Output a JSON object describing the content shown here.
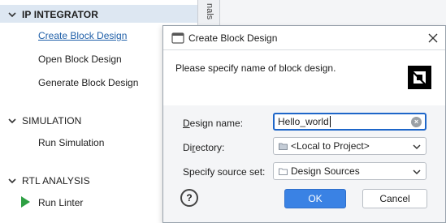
{
  "flow_navigator": {
    "sections": [
      {
        "label": "IP INTEGRATOR",
        "expanded": true,
        "items": [
          "Create Block Design",
          "Open Block Design",
          "Generate Block Design"
        ]
      },
      {
        "label": "SIMULATION",
        "expanded": true,
        "items": [
          "Run Simulation"
        ]
      },
      {
        "label": "RTL ANALYSIS",
        "expanded": true,
        "items": [
          "Run Linter"
        ]
      }
    ]
  },
  "side_tab": {
    "label": "nals"
  },
  "dialog": {
    "title": "Create Block Design",
    "description": "Please specify name of block design.",
    "fields": {
      "design_name": {
        "label_mnemonic": "D",
        "label_rest": "esign name:",
        "value": "Hello_world"
      },
      "directory": {
        "label_pre": "Di",
        "label_mnemonic": "r",
        "label_post": "ectory:",
        "value": "<Local to Project>"
      },
      "source_set": {
        "label": "Specify source set:",
        "value": "Design Sources"
      }
    },
    "buttons": {
      "ok": "OK",
      "cancel": "Cancel",
      "help": "?"
    }
  },
  "colors": {
    "accent": "#3a82e4",
    "link": "#1f5fa8",
    "highlight": "#dde7f2",
    "run_icon": "#2ea043"
  },
  "icons": [
    "chevron-down-icon",
    "play-icon",
    "app-icon",
    "close-icon",
    "amd-logo",
    "clear-icon",
    "folder-icon",
    "dropdown-arrow-icon",
    "help-icon"
  ]
}
